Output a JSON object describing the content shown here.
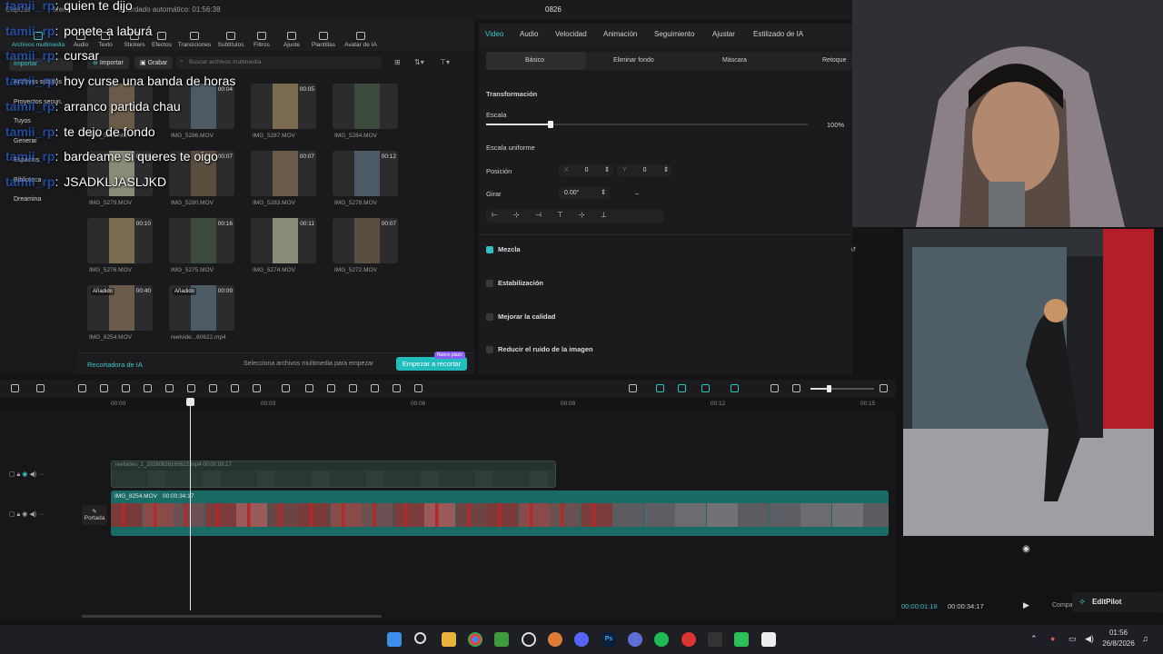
{
  "topbar": {
    "app_name": "CapCut",
    "menu": "Menú",
    "autosave": "Guardado automático: 01:56:38",
    "project_title": "0826"
  },
  "tools": [
    {
      "label": "Archivos multimedia",
      "icon": "media-icon"
    },
    {
      "label": "Audio",
      "icon": "audio-icon"
    },
    {
      "label": "Texto",
      "icon": "text-icon"
    },
    {
      "label": "Stickers",
      "icon": "sticker-icon"
    },
    {
      "label": "Efectos",
      "icon": "effects-icon"
    },
    {
      "label": "Transiciones",
      "icon": "transitions-icon"
    },
    {
      "label": "Subtítulos",
      "icon": "subtitles-icon"
    },
    {
      "label": "Filtros",
      "icon": "filters-icon"
    },
    {
      "label": "Ajuste",
      "icon": "adjust-icon"
    },
    {
      "label": "Plantillas",
      "icon": "templates-icon"
    },
    {
      "label": "Avatar de IA",
      "icon": "avatar-icon"
    }
  ],
  "sidebar": {
    "items": [
      "Importar",
      "Archivos subidos",
      "Proyectos secun.",
      "Tuyos",
      "Generar",
      "Espacios",
      "Biblioteca",
      "Dreamina"
    ]
  },
  "media": {
    "import_label": "Importar",
    "record_label": "Grabar",
    "search_placeholder": "Buscar archivos multimedia",
    "items": [
      {
        "name": "IMG_5289.MOV",
        "duration": "",
        "badge": ""
      },
      {
        "name": "IMG_5286.MOV",
        "duration": "00:04",
        "badge": ""
      },
      {
        "name": "IMG_5287.MOV",
        "duration": "00:05",
        "badge": ""
      },
      {
        "name": "IMG_5284.MOV",
        "duration": "",
        "badge": ""
      },
      {
        "name": "IMG_5279.MOV",
        "duration": "00:08",
        "badge": ""
      },
      {
        "name": "IMG_5280.MOV",
        "duration": "00:07",
        "badge": ""
      },
      {
        "name": "IMG_5283.MOV",
        "duration": "00:07",
        "badge": ""
      },
      {
        "name": "IMG_5278.MOV",
        "duration": "00:12",
        "badge": ""
      },
      {
        "name": "IMG_5276.MOV",
        "duration": "00:10",
        "badge": ""
      },
      {
        "name": "IMG_5275.MOV",
        "duration": "00:16",
        "badge": ""
      },
      {
        "name": "IMG_5274.MOV",
        "duration": "00:11",
        "badge": ""
      },
      {
        "name": "IMG_5272.MOV",
        "duration": "00:07",
        "badge": ""
      },
      {
        "name": "IMG_8254.MOV",
        "duration": "00:40",
        "badge": "Añadido"
      },
      {
        "name": "reelvide...60622.mp4",
        "duration": "00:09",
        "badge": "Añadido"
      }
    ],
    "footer_left": "Recortadora de IA",
    "footer_mid": "Selecciona archivos multimedia para empezar",
    "footer_button": "Empezar a recortar",
    "footer_new": "Nuevo plazo"
  },
  "chat": [
    {
      "user": "tamii_rp",
      "msg": "quien te dijo"
    },
    {
      "user": "tamii_rp",
      "msg": "ponete a laburá"
    },
    {
      "user": "tamii_rp",
      "msg": "cursar"
    },
    {
      "user": "tamii_rp",
      "msg": "hoy curse una banda de horas"
    },
    {
      "user": "tamii_rp",
      "msg": "arranco partida chau"
    },
    {
      "user": "tamii_rp",
      "msg": "te dejo de fondo"
    },
    {
      "user": "tamii_rp",
      "msg": "bardeame si queres te oigo"
    },
    {
      "user": "tamii_rp",
      "msg": "JSADKLJASLJKD"
    }
  ],
  "props": {
    "tabs": [
      "Video",
      "Audio",
      "Velocidad",
      "Animación",
      "Seguimiento",
      "Ajustar",
      "Estilizado de IA"
    ],
    "subtabs": [
      "Básico",
      "Eliminar fondo",
      "Máscara",
      "Retoque"
    ],
    "transform": "Transformación",
    "scale_label": "Escala",
    "scale_value": "100%",
    "scale_fraction": 0.2,
    "uniform_label": "Escala uniforme",
    "position_label": "Posición",
    "pos_x_label": "X",
    "pos_x": "0",
    "pos_y_label": "Y",
    "pos_y": "0",
    "rotate_label": "Girar",
    "rotate_value": "0.00°",
    "blend": "Mezcla",
    "stabilize": "Estabilización",
    "quality": "Mejorar la calidad",
    "noise": "Reducir el ruido de la imagen"
  },
  "timeline": {
    "ticks": [
      "00:00",
      "00:03",
      "00:06",
      "00:09",
      "00:12",
      "00:15"
    ],
    "overlay_clip": "reelvideo_1_20260826160622.mp4   00:00:09:17",
    "main_clip_name": "IMG_8254.MOV",
    "main_clip_duration": "00:00:34:17",
    "cover_label": "Portada"
  },
  "preview": {
    "current_time": "00:00:01:18",
    "total_time": "00:00:34:17",
    "editpilot": "EditPilot",
    "compare": "Comparar"
  },
  "taskbar": {
    "time": "01:56",
    "date": "26/8/2026"
  },
  "colors": {
    "accent": "#2fc1c1",
    "chat_user": "#2a73ff"
  }
}
